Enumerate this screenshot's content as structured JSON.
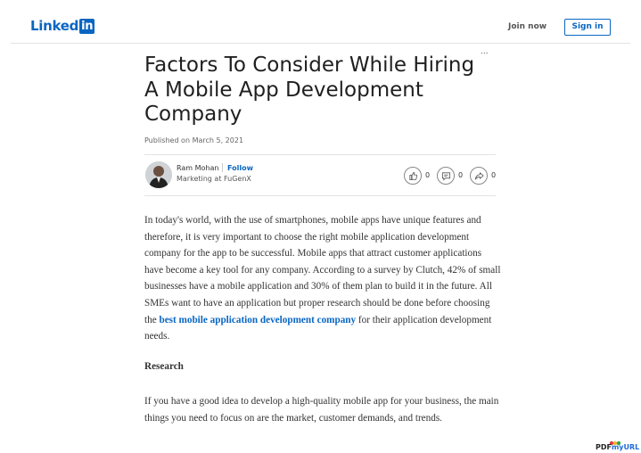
{
  "header": {
    "logo_text": "Linked",
    "logo_box_text": "in",
    "join_label": "Join now",
    "signin_label": "Sign in"
  },
  "article": {
    "more_label": "...",
    "title": "Factors To Consider While Hiring A Mobile App Development Company",
    "published": "Published on March 5, 2021",
    "author": {
      "name": "Ram Mohan",
      "follow_label": "Follow",
      "headline": "Marketing at FuGenX"
    },
    "social": {
      "like_count": "0",
      "comment_count": "0",
      "share_count": "0"
    },
    "paragraph1_before": "In today's world, with the use of smartphones, mobile apps have unique features and therefore, it is very important to choose the right mobile application development company for the app to be successful. Mobile apps that attract customer applications have become a key tool for any company. According to a survey by Clutch, 42% of small businesses have a mobile application and 30% of them plan to build it in the future. All SMEs want to have an application but proper research should be done before choosing the ",
    "paragraph1_link": "best mobile application development company",
    "paragraph1_after": " for their application development needs.",
    "heading": "Research",
    "paragraph2": "If you have a good idea to develop a high-quality mobile app for your business, the main things you need to focus on are the market, customer demands, and trends."
  },
  "watermark": {
    "text_a": "PDF",
    "text_b": "myURL"
  },
  "colors": {
    "brand": "#0a66c2",
    "text": "#1f1f1f"
  }
}
